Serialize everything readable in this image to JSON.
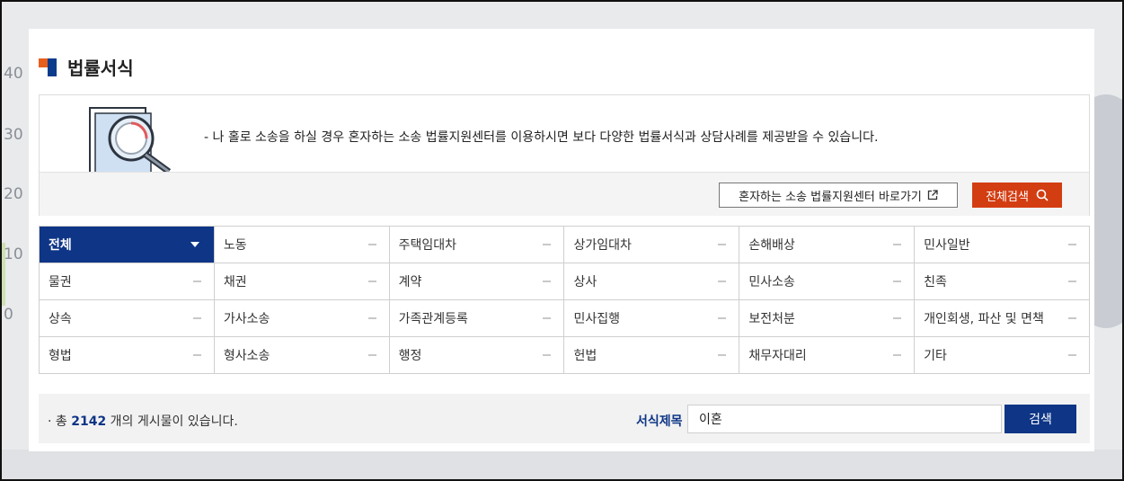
{
  "background": {
    "axis_labels": [
      "40",
      "30",
      "20",
      "10",
      "0"
    ]
  },
  "header": {
    "title": "법률서식"
  },
  "info": {
    "description": "- 나 홀로 소송을 하실 경우 혼자하는 소송 법률지원센터를 이용하시면 보다 다양한 법률서식과 상담사례를 제공받을 수 있습니다.",
    "center_button_label": "혼자하는 소송 법률지원센터 바로가기",
    "search_all_label": "전체검색"
  },
  "categories": [
    {
      "label": "전체",
      "active": true
    },
    {
      "label": "노동"
    },
    {
      "label": "주택임대차"
    },
    {
      "label": "상가임대차"
    },
    {
      "label": "손해배상"
    },
    {
      "label": "민사일반"
    },
    {
      "label": "물권"
    },
    {
      "label": "채권"
    },
    {
      "label": "계약"
    },
    {
      "label": "상사"
    },
    {
      "label": "민사소송"
    },
    {
      "label": "친족"
    },
    {
      "label": "상속"
    },
    {
      "label": "가사소송"
    },
    {
      "label": "가족관계등록"
    },
    {
      "label": "민사집행"
    },
    {
      "label": "보전처분"
    },
    {
      "label": "개인회생, 파산 및 면책"
    },
    {
      "label": "형법"
    },
    {
      "label": "형사소송"
    },
    {
      "label": "행정"
    },
    {
      "label": "헌법"
    },
    {
      "label": "채무자대리"
    },
    {
      "label": "기타"
    }
  ],
  "results": {
    "prefix": "· 총",
    "count": "2142",
    "suffix": "개의 게시물이 있습니다."
  },
  "search": {
    "field_label": "서식제목",
    "query": "이혼",
    "button_label": "검색"
  },
  "colors": {
    "navy": "#0e3586",
    "orange": "#d33d12"
  }
}
